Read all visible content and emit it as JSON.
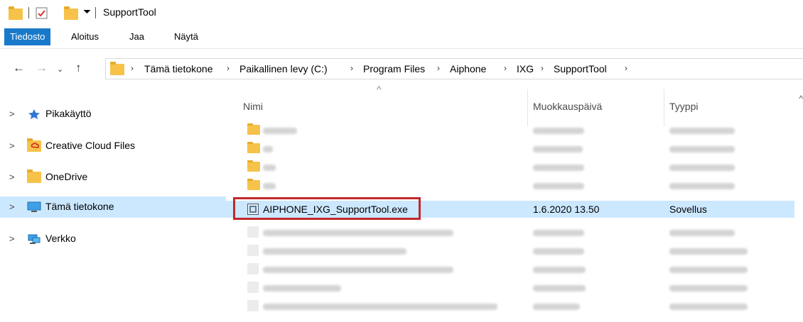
{
  "window": {
    "title": "SupportTool"
  },
  "ribbon": {
    "tabs": [
      "Tiedosto",
      "Aloitus",
      "Jaa",
      "Näytä"
    ]
  },
  "address": {
    "crumbs": [
      "Tämä tietokone",
      "Paikallinen levy (C:)",
      "Program Files",
      "Aiphone",
      "IXG",
      "SupportTool"
    ]
  },
  "sidebar": {
    "items": [
      {
        "label": "Pikakäyttö",
        "icon": "star-icon"
      },
      {
        "label": "Creative Cloud Files",
        "icon": "creative-cloud-folder-icon"
      },
      {
        "label": "OneDrive",
        "icon": "folder-icon"
      },
      {
        "label": "Tämä tietokone",
        "icon": "computer-icon"
      },
      {
        "label": "Verkko",
        "icon": "network-icon"
      }
    ]
  },
  "columns": {
    "name": "Nimi",
    "date": "Muokkauspäivä",
    "type": "Tyyppi"
  },
  "selected_file": {
    "name": "AIPHONE_IXG_SupportTool.exe",
    "date": "1.6.2020 13.50",
    "type": "Sovellus"
  },
  "colors": {
    "accent": "#1979ca",
    "selection": "#cce8ff",
    "highlight": "#c0282a",
    "folder": "#f6c24a"
  }
}
